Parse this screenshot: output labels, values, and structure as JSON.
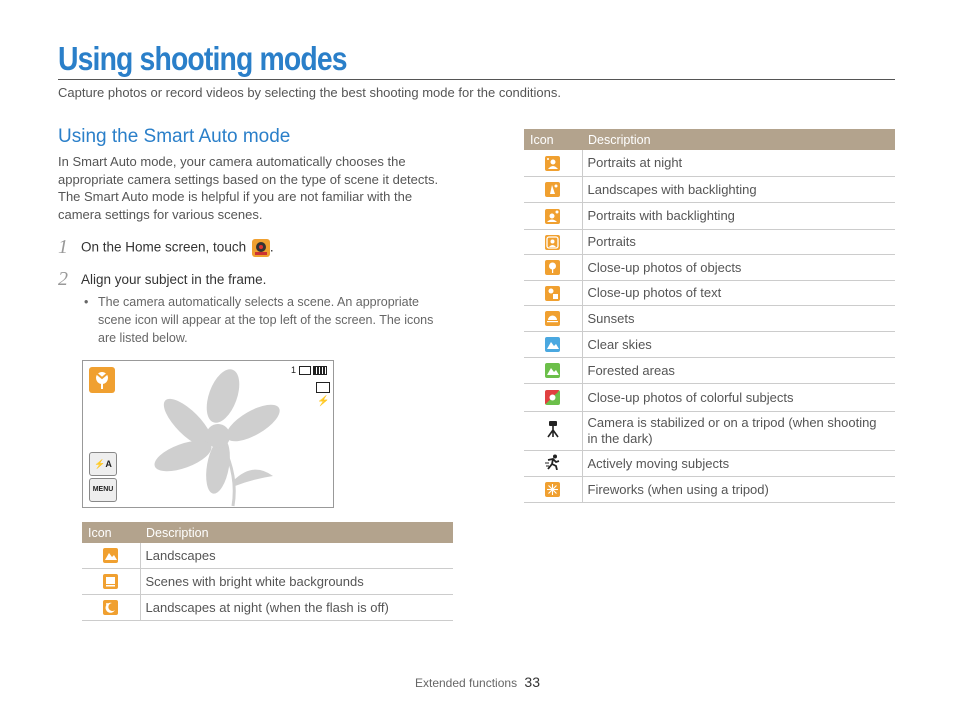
{
  "page": {
    "title": "Using shooting modes",
    "subtitle": "Capture photos or record videos by selecting the best shooting mode for the conditions."
  },
  "section": {
    "title": "Using the Smart Auto mode",
    "intro": "In Smart Auto mode, your camera automatically chooses the appropriate camera settings based on the type of scene it detects. The Smart Auto mode is helpful if you are not familiar with the camera settings for various scenes."
  },
  "steps": [
    {
      "number": "1",
      "text": "On the Home screen, touch",
      "suffix": ".",
      "icon": "smart-auto-mode-icon"
    },
    {
      "number": "2",
      "text": "Align your subject in the frame."
    }
  ],
  "bullet": {
    "mark": "•",
    "text": "The camera automatically selects a scene. An appropriate scene icon will appear at the top left of the screen. The icons are listed below."
  },
  "preview": {
    "scene_icon": "close-up-objects-icon",
    "shot_count": "1",
    "flash_label": "⚡A",
    "menu_label": "MENU"
  },
  "table_headers": {
    "icon": "Icon",
    "description": "Description"
  },
  "table_left": [
    {
      "icon": "landscape-icon",
      "description": "Landscapes"
    },
    {
      "icon": "white-background-icon",
      "description": "Scenes with bright white backgrounds"
    },
    {
      "icon": "night-landscape-icon",
      "description": "Landscapes at night (when the flash is off)"
    }
  ],
  "table_right": [
    {
      "icon": "night-portrait-icon",
      "description": "Portraits at night"
    },
    {
      "icon": "backlight-landscape-icon",
      "description": "Landscapes with backlighting"
    },
    {
      "icon": "backlight-portrait-icon",
      "description": "Portraits with backlighting"
    },
    {
      "icon": "portrait-icon",
      "description": "Portraits"
    },
    {
      "icon": "macro-object-icon",
      "description": "Close-up photos of objects"
    },
    {
      "icon": "macro-text-icon",
      "description": "Close-up photos of text"
    },
    {
      "icon": "sunset-icon",
      "description": "Sunsets"
    },
    {
      "icon": "clear-sky-icon",
      "description": "Clear skies"
    },
    {
      "icon": "forest-icon",
      "description": "Forested areas"
    },
    {
      "icon": "macro-color-icon",
      "description": "Close-up photos of colorful subjects"
    },
    {
      "icon": "tripod-icon",
      "description": "Camera is stabilized or on a tripod (when shooting in the dark)"
    },
    {
      "icon": "action-icon",
      "description": "Actively moving subjects"
    },
    {
      "icon": "fireworks-icon",
      "description": "Fireworks (when using a tripod)"
    }
  ],
  "footer": {
    "section": "Extended functions",
    "page_number": "33"
  },
  "colors": {
    "accent": "#2a7fc9",
    "table_header": "#b3a38d",
    "icon_orange": "#f0a030",
    "icon_blue": "#4aa8e0",
    "icon_green": "#6cbf4a"
  }
}
